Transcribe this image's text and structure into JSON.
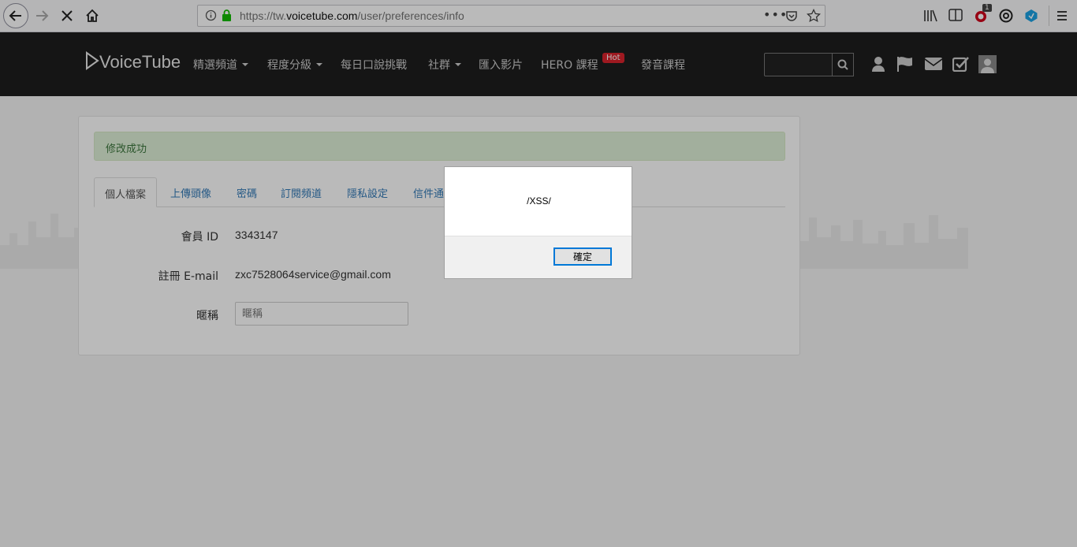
{
  "browser": {
    "url_prefix": "https://tw.",
    "url_domain": "voicetube.com",
    "url_path": "/user/preferences/info",
    "badge_count": "1",
    "icons": [
      "back-icon",
      "forward-icon",
      "stop-icon",
      "home-icon",
      "info-icon",
      "lock-icon",
      "more-icon",
      "pocket-icon",
      "bookmark-star-icon",
      "library-icon",
      "sidebar-icon",
      "extension-icon",
      "extension2-icon",
      "extension3-icon",
      "menu-icon"
    ]
  },
  "site": {
    "logo": "VoiceTube",
    "nav": [
      {
        "label": "精選頻道",
        "dropdown": true
      },
      {
        "label": "程度分級",
        "dropdown": true
      },
      {
        "label": "每日口說挑戰",
        "dropdown": false
      },
      {
        "label": "社群",
        "dropdown": true
      },
      {
        "label": "匯入影片",
        "dropdown": false
      },
      {
        "label": "HERO 課程",
        "dropdown": false
      },
      {
        "label": "發音課程",
        "dropdown": false
      }
    ],
    "hot_badge": "Hot",
    "search_value": ""
  },
  "page": {
    "alert": "修改成功",
    "tabs": [
      "個人檔案",
      "上傳頭像",
      "密碼",
      "訂閱頻道",
      "隱私設定",
      "信件通"
    ],
    "member_id_label": "會員 ID",
    "member_id": "3343147",
    "email_label": "註冊 E-mail",
    "email": "zxc7528064service@gmail.com",
    "nickname_label": "暱稱",
    "nickname_placeholder": "暱稱"
  },
  "dialog": {
    "message": "/XSS/",
    "ok_label": "確定"
  },
  "colors": {
    "nav_bg": "#1e1e1e",
    "alert_bg": "#dff0d8",
    "link": "#337ab7",
    "hot": "#d9232d"
  }
}
